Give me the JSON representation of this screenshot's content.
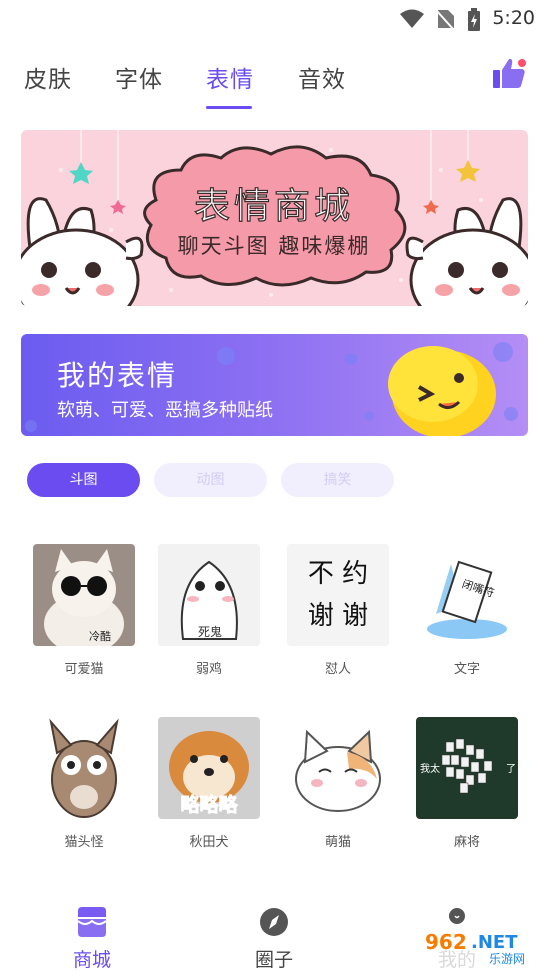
{
  "status": {
    "time": "5:20"
  },
  "tabs": [
    {
      "label": "皮肤"
    },
    {
      "label": "字体"
    },
    {
      "label": "表情"
    },
    {
      "label": "音效"
    }
  ],
  "active_tab": "表情",
  "banner1": {
    "title": "表情商城",
    "subtitle": "聊天斗图 趣味爆棚"
  },
  "banner2": {
    "title": "我的表情",
    "subtitle": "软萌、可爱、恶搞多种贴纸"
  },
  "chips": [
    {
      "label": "斗图"
    },
    {
      "label": "动图"
    },
    {
      "label": "搞笑"
    }
  ],
  "grid": [
    {
      "label": "可爱猫",
      "caption": "冷酷"
    },
    {
      "label": "弱鸡",
      "caption": "死鬼"
    },
    {
      "label": "怼人",
      "caption": "不约 谢谢"
    },
    {
      "label": "文字",
      "caption": "闭嘴符"
    },
    {
      "label": "猫头怪",
      "caption": ""
    },
    {
      "label": "秋田犬",
      "caption": "略略略"
    },
    {
      "label": "萌猫",
      "caption": ""
    },
    {
      "label": "麻将",
      "caption": "我太 了"
    }
  ],
  "nav": [
    {
      "label": "商城"
    },
    {
      "label": "圈子"
    },
    {
      "label": "我的"
    }
  ],
  "watermark": {
    "a": "962",
    "b": ".NET",
    "c": "乐游网"
  },
  "colors": {
    "accent": "#6a4cf0",
    "chip_inactive": "#f1eefe"
  }
}
